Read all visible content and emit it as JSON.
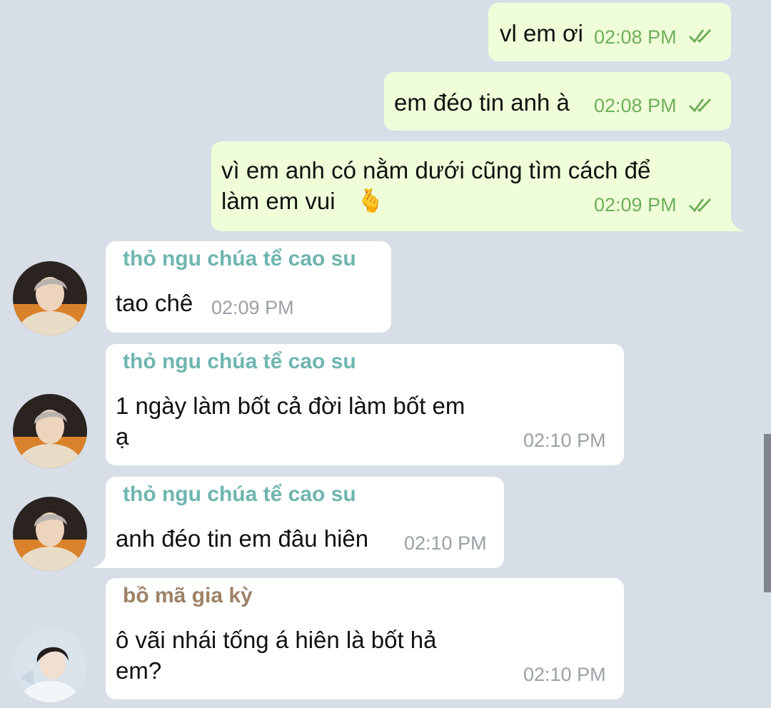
{
  "messages": [
    {
      "text": "vl em ơi",
      "time": "02:08 PM"
    },
    {
      "text": "em đéo tin anh à",
      "time": "02:08 PM"
    },
    {
      "line1": "vì em anh có nằm dưới cũng tìm cách để",
      "line2": "làm em vui",
      "emoji": "🫰",
      "time": "02:09 PM"
    },
    {
      "sender": "thỏ ngu chúa tể cao su",
      "text": "tao chê",
      "time": "02:09 PM"
    },
    {
      "sender": "thỏ ngu chúa tể cao su",
      "line1": "1 ngày làm bốt cả đời làm bốt em",
      "line2": "ạ",
      "time": "02:10 PM"
    },
    {
      "sender": "thỏ ngu chúa tể cao su",
      "text": "anh đéo tin em đâu hiên",
      "time": "02:10 PM"
    },
    {
      "sender": "bồ mã gia kỳ",
      "line1": "ô vãi nhái tống á hiên là bốt hả",
      "line2": "em?",
      "time": "02:10 PM"
    }
  ],
  "colors": {
    "background": "#d7dee7",
    "outgoing_bubble": "#effed9",
    "incoming_bubble": "#ffffff",
    "sender_teal": "#6fb5b0",
    "sender_brown": "#9e8166",
    "outgoing_time": "#6fae5a",
    "incoming_time": "#9aa0a6"
  },
  "icons": {
    "read_receipt": "double-check-icon",
    "avatar_1": "user-avatar",
    "avatar_2": "user-avatar"
  }
}
